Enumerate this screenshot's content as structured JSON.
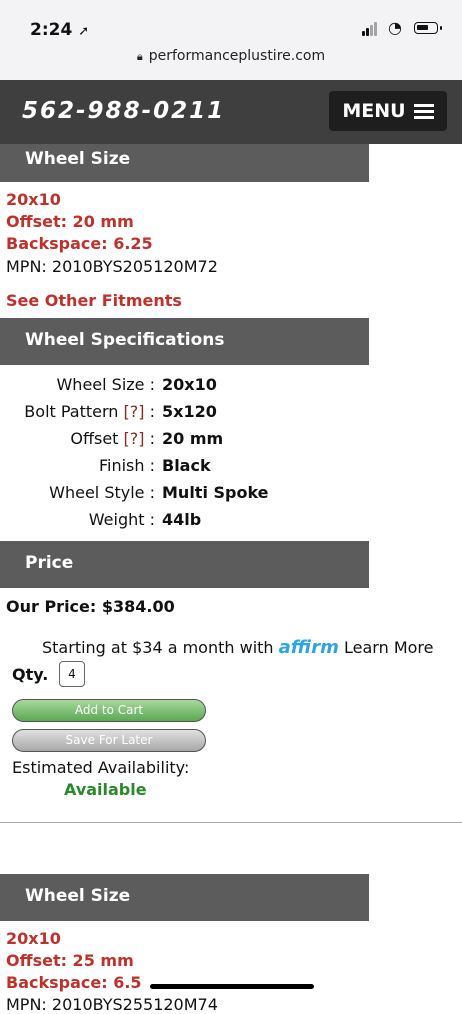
{
  "status": {
    "time": "2:24",
    "url": "performanceplustire.com"
  },
  "header": {
    "phone": "562-988-0211",
    "menu_label": "MENU"
  },
  "fitment1": {
    "section_title": "Wheel Size",
    "size": "20x10",
    "offset": "Offset: 20 mm",
    "backspace": "Backspace: 6.25",
    "mpn": "MPN: 2010BYS205120M72",
    "see_other": "See Other Fitments"
  },
  "specs": {
    "section_title": "Wheel Specifications",
    "rows": [
      {
        "label": "Wheel Size",
        "help": "",
        "value": "20x10"
      },
      {
        "label": "Bolt Pattern",
        "help": "[?]",
        "value": "5x120"
      },
      {
        "label": "Offset",
        "help": "[?]",
        "value": "20 mm"
      },
      {
        "label": "Finish",
        "help": "",
        "value": "Black"
      },
      {
        "label": "Wheel Style",
        "help": "",
        "value": "Multi Spoke"
      },
      {
        "label": "Weight",
        "help": "",
        "value": "44lb"
      }
    ],
    "separator": " :"
  },
  "price": {
    "section_title": "Price",
    "our_price": "Our Price: $384.00",
    "affirm_text": "Starting at $34 a month with",
    "affirm_logo": "affirm",
    "learn_more": "Learn More",
    "qty_label": "Qty.",
    "qty_value": "4",
    "add_to_cart": "Add to Cart",
    "save_later": "Save For Later",
    "availability_label": "Estimated Availability:",
    "availability_value": "Available"
  },
  "fitment2": {
    "section_title": "Wheel Size",
    "size": "20x10",
    "offset": "Offset: 25 mm",
    "backspace": "Backspace: 6.5",
    "mpn": "MPN: 2010BYS255120M74"
  },
  "colors": {
    "accent_red": "#c0312b",
    "available_green": "#2a8a2a",
    "header_bg": "#3f3f3f",
    "section_bg": "#5c5c5c",
    "affirm_blue": "#2ea4e8"
  }
}
